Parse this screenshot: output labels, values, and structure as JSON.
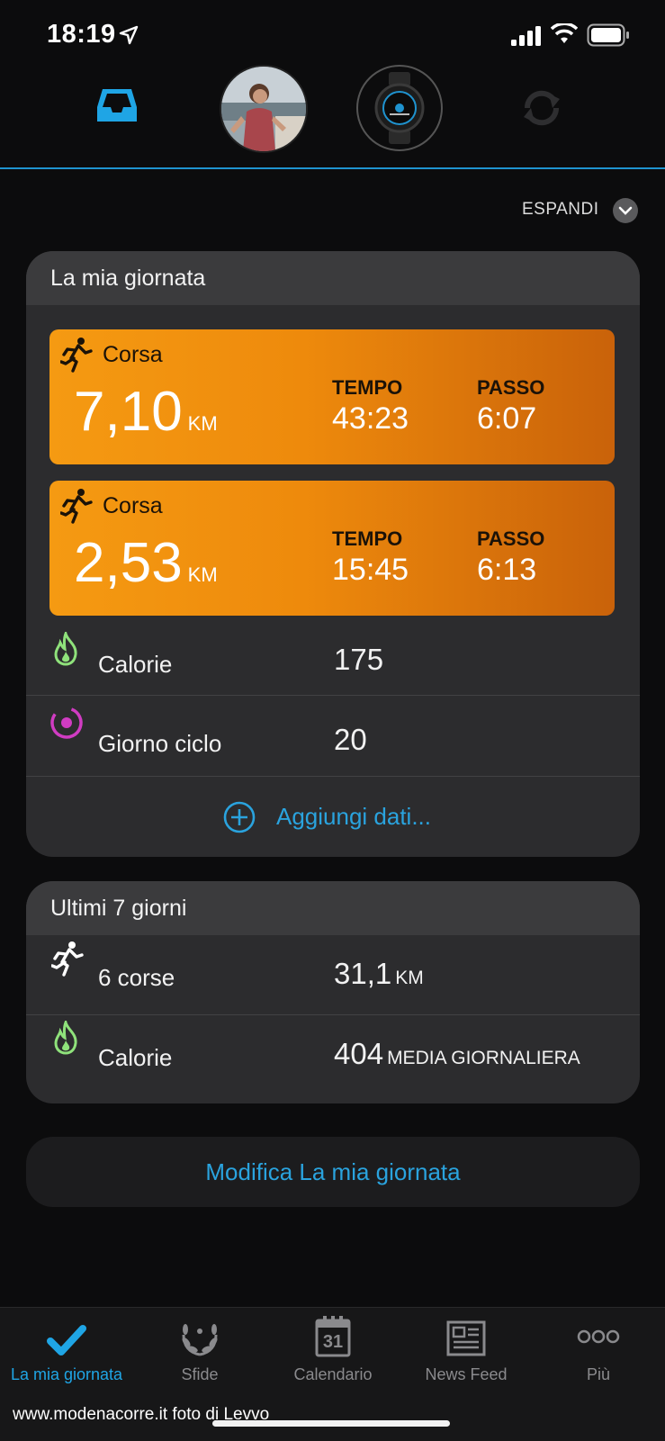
{
  "status": {
    "time": "18:19"
  },
  "header": {
    "expand_label": "ESPANDI",
    "icons": [
      "inbox-icon",
      "avatar",
      "watch-icon",
      "sync-icon"
    ]
  },
  "my_day": {
    "title": "La mia giornata",
    "activities": [
      {
        "type": "Corsa",
        "distance": "7,10",
        "unit": "KM",
        "time_label": "TEMPO",
        "time": "43:23",
        "pace_label": "PASSO",
        "pace": "6:07"
      },
      {
        "type": "Corsa",
        "distance": "2,53",
        "unit": "KM",
        "time_label": "TEMPO",
        "time": "15:45",
        "pace_label": "PASSO",
        "pace": "6:13"
      }
    ],
    "calories_label": "Calorie",
    "calories_value": "175",
    "cycle_label": "Giorno ciclo",
    "cycle_value": "20",
    "add_data": "Aggiungi dati..."
  },
  "last7": {
    "title": "Ultimi 7 giorni",
    "runs_label": "6 corse",
    "runs_value": "31,1",
    "runs_unit": "KM",
    "calories_label": "Calorie",
    "calories_value": "404",
    "calories_unit": "MEDIA GIORNALIERA"
  },
  "edit_button": "Modifica La mia giornata",
  "tabs": [
    {
      "label": "La mia giornata",
      "icon": "check-icon",
      "active": true
    },
    {
      "label": "Sfide",
      "icon": "laurel-icon",
      "active": false
    },
    {
      "label": "Calendario",
      "icon": "calendar-icon",
      "active": false,
      "badge": "31"
    },
    {
      "label": "News Feed",
      "icon": "newspaper-icon",
      "active": false
    },
    {
      "label": "Più",
      "icon": "more-icon",
      "active": false
    }
  ],
  "credit": "www.modenacorre.it foto di Levvo",
  "colors": {
    "accent": "#2aa3de",
    "activity_orange": "#f59a12",
    "card": "#2c2c2e",
    "background": "#0c0c0d"
  }
}
